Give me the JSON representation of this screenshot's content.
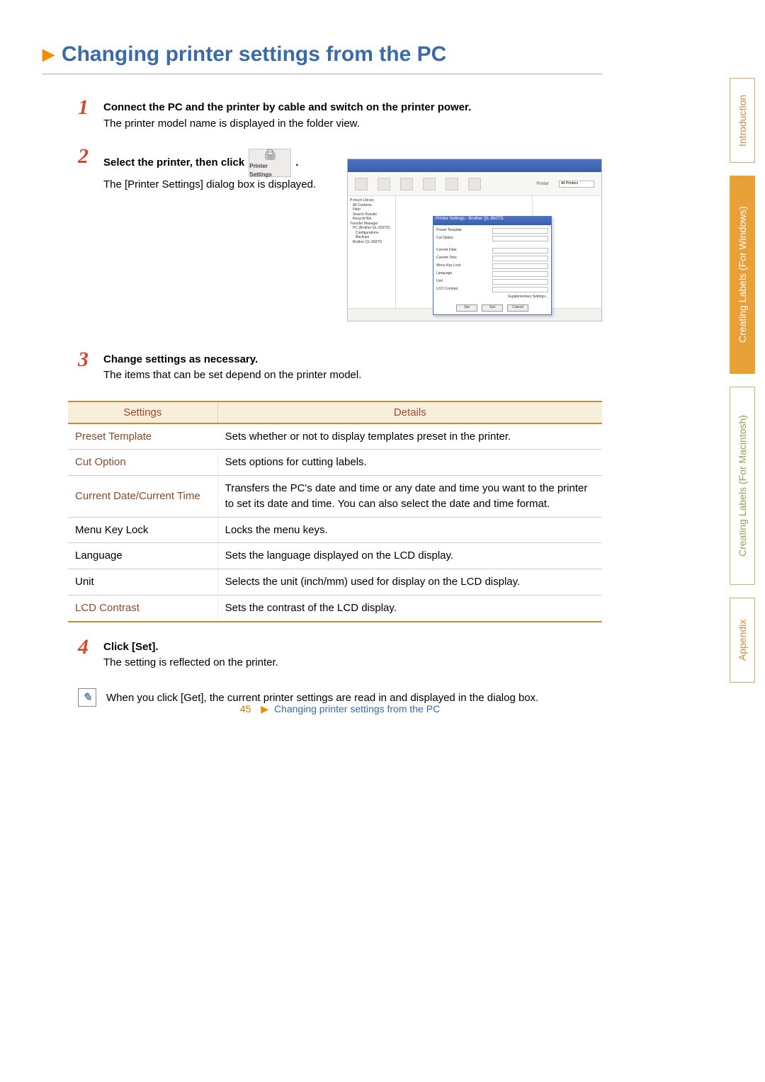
{
  "title": "Changing printer settings from the PC",
  "step1": {
    "bold": "Connect the PC and the printer by cable and switch on the printer power.",
    "text": "The printer model name is displayed in the folder view."
  },
  "step2": {
    "bold_pre": "Select the printer, then click ",
    "icon_label": "Printer Settings",
    "bold_post": ".",
    "text": "The [Printer Settings] dialog box is displayed."
  },
  "step3": {
    "bold": "Change settings as necessary.",
    "text": "The items that can be set depend on the printer model."
  },
  "table": {
    "headers": {
      "settings": "Settings",
      "details": "Details"
    },
    "rows": [
      {
        "name": "Preset Template",
        "color": "accent",
        "details": "Sets whether or not to display templates preset in the printer."
      },
      {
        "name": "Cut Option",
        "color": "accent",
        "details": "Sets options for cutting labels."
      },
      {
        "name": "Current Date/Current Time",
        "color": "accent",
        "details": "Transfers the PC's date and time or any date and time you want to the printer to set its date and time. You can also select the date and time format."
      },
      {
        "name": "Menu Key Lock",
        "color": "black",
        "details": "Locks the menu keys."
      },
      {
        "name": "Language",
        "color": "black",
        "details": "Sets the language displayed on the LCD display."
      },
      {
        "name": "Unit",
        "color": "black",
        "details": "Selects the unit (inch/mm) used for display on the LCD display."
      },
      {
        "name": "LCD Contrast",
        "color": "accent",
        "details": "Sets the contrast of the LCD display."
      }
    ]
  },
  "step4": {
    "bold": "Click [Set].",
    "text": "The setting is reflected on the printer."
  },
  "note": "When you click [Get], the current printer settings are read in and displayed in the dialog box.",
  "footer": {
    "page_number": "45",
    "title": "Changing printer settings from the PC"
  },
  "screenshot": {
    "modal_title": "Printer Settings - Brother QL-650TD",
    "toolbar_search_label": "Printer",
    "toolbar_combo": "All Printers",
    "modal_rows": {
      "preset_template": "Preset Template",
      "cut_option": "Cut Option",
      "current_date": "Current Date",
      "current_time": "Current Time",
      "menu_lock": "Menu Key Lock",
      "language": "Language",
      "unit": "Unit",
      "lcd_contrast": "LCD Contrast",
      "suppl": "Supplementary Settings..."
    },
    "modal_buttons": {
      "set": "Set",
      "get": "Get",
      "cancel": "Cancel"
    },
    "tree_items": [
      "P-touch Library",
      "All Contents",
      "Filter",
      "Search Results",
      "Recycle Bin",
      "Transfer Manager",
      "PC (Brother QL-650TD)",
      "Configurations",
      "Backups",
      "Brother QL-650TD"
    ]
  },
  "tabs": {
    "intro": "Introduction",
    "win": "Creating Labels (For Windows)",
    "mac": "Creating Labels (For Macintosh)",
    "appx": "Appendix"
  }
}
